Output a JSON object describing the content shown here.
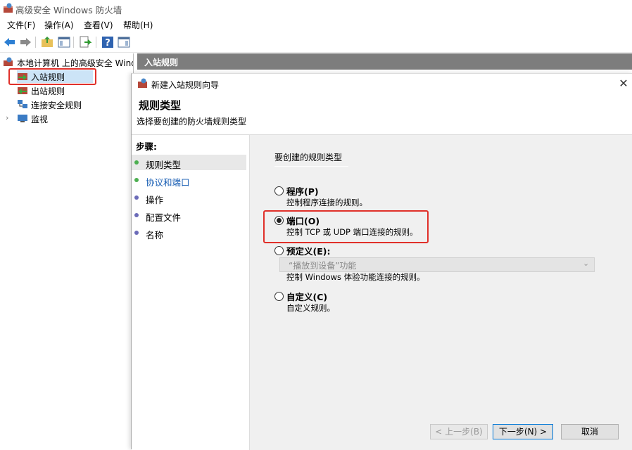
{
  "window": {
    "title": "高级安全 Windows 防火墙"
  },
  "menu": [
    "文件(F)",
    "操作(A)",
    "查看(V)",
    "帮助(H)"
  ],
  "toolbar": {
    "icons": [
      "back-arrow-icon",
      "forward-arrow-icon",
      "up-folder-icon",
      "show-hide-tree-icon",
      "export-list-icon",
      "help-icon",
      "show-hide-action-pane-icon"
    ]
  },
  "tree": {
    "root": "本地计算机 上的高级安全 Windows 防火墙",
    "items": [
      "入站规则",
      "出站规则",
      "连接安全规则",
      "监视"
    ]
  },
  "rpanel": {
    "header": "入站规则"
  },
  "dialog": {
    "title": "新建入站规则向导",
    "heading": "规则类型",
    "subtitle": "选择要创建的防火墙规则类型",
    "steps_label": "步骤:",
    "steps": [
      "规则类型",
      "协议和端口",
      "操作",
      "配置文件",
      "名称"
    ],
    "question": "要创建的规则类型",
    "options": [
      {
        "title": "程序(P)",
        "desc": "控制程序连接的规则。",
        "checked": false
      },
      {
        "title": "端口(O)",
        "desc": "控制 TCP 或 UDP 端口连接的规则。",
        "checked": true
      },
      {
        "title": "预定义(E):",
        "desc": "控制 Windows 体验功能连接的规则。",
        "checked": false
      },
      {
        "title": "自定义(C)",
        "desc": "自定义规则。",
        "checked": false
      }
    ],
    "predefined_select": "“播放到设备”功能",
    "buttons": {
      "back": "< 上一步(B)",
      "next": "下一步(N) >",
      "cancel": "取消"
    }
  },
  "colors": {
    "header_bg": "#7d7d7d",
    "highlight_red": "#e0302a",
    "step_active_dot": "#4caf50",
    "link_blue": "#1a5fb4"
  }
}
